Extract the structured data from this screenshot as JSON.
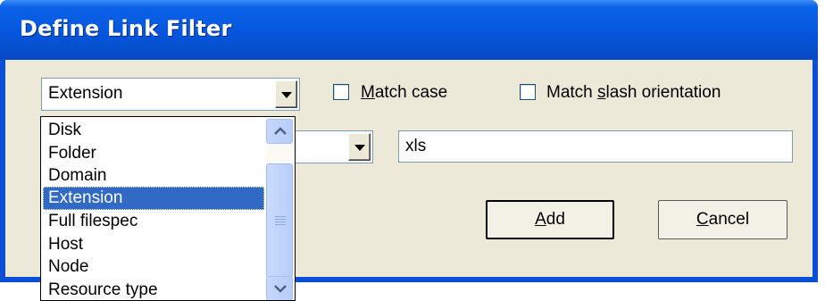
{
  "window": {
    "title": "Define Link Filter"
  },
  "filter_type_combo": {
    "value": "Extension"
  },
  "operator_combo": {
    "value": ""
  },
  "match_case": {
    "label_prefix": "",
    "label_accel": "M",
    "label_rest": "atch case",
    "checked": false
  },
  "match_slash": {
    "label_prefix": "Match ",
    "label_accel": "s",
    "label_rest": "lash orientation",
    "checked": false
  },
  "value_input": {
    "value": "xls"
  },
  "buttons": {
    "add": {
      "accel": "A",
      "rest": "dd"
    },
    "cancel": {
      "accel": "C",
      "rest": "ancel"
    }
  },
  "dropdown": {
    "items": [
      "Disk",
      "Folder",
      "Domain",
      "Extension",
      "Full filespec",
      "Host",
      "Node",
      "Resource type"
    ],
    "selected": "Extension"
  },
  "icons": {
    "combo_arrow": "chevron-down-icon",
    "scroll_up": "scroll-up-arrow-icon",
    "scroll_down": "scroll-down-arrow-icon",
    "scroll_grip": "scroll-grip-icon"
  },
  "colors": {
    "titlebar": "#0656dd",
    "client": "#ece9d8",
    "selection": "#316ac5"
  }
}
